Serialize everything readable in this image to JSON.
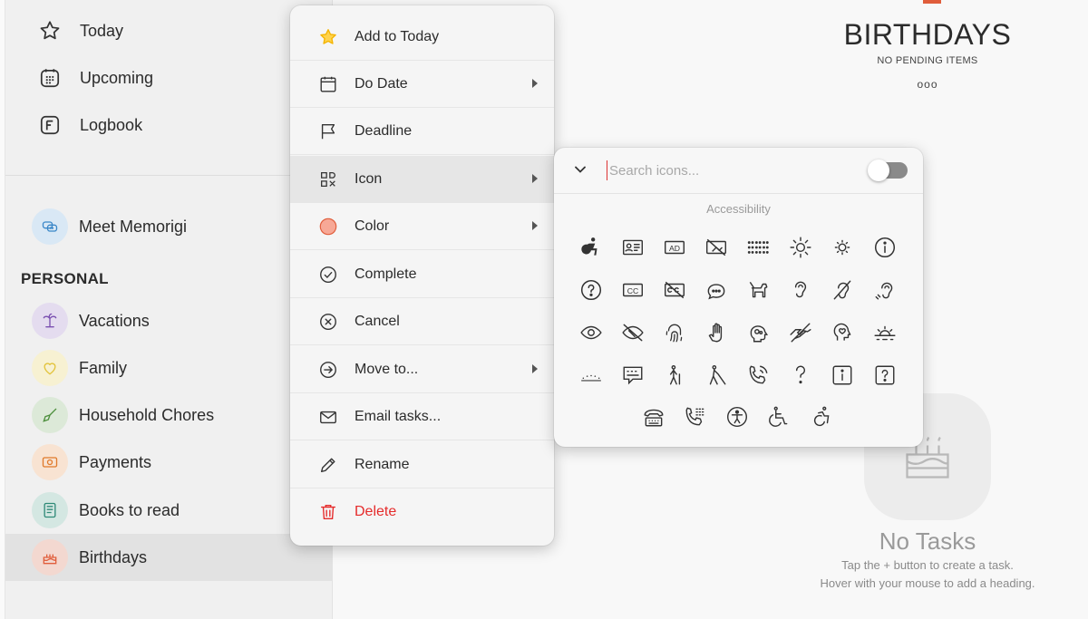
{
  "sidebar": {
    "nav": [
      {
        "label": "Today",
        "icon": "star-icon"
      },
      {
        "label": "Upcoming",
        "icon": "calendar-grid-icon"
      },
      {
        "label": "Logbook",
        "icon": "logbook-icon"
      }
    ],
    "meet": {
      "label": "Meet Memorigi",
      "icon": "chat-bubbles-icon",
      "color": "#d9e8f5"
    },
    "section": "PERSONAL",
    "lists": [
      {
        "label": "Vacations",
        "icon": "palm-tree-icon",
        "bg": "#e4dcef",
        "fg": "#7a4fb0"
      },
      {
        "label": "Family",
        "icon": "heart-icon",
        "bg": "#f7f1d2",
        "fg": "#e2c33b"
      },
      {
        "label": "Household Chores",
        "icon": "broom-icon",
        "bg": "#dce9d8",
        "fg": "#4c8f3c"
      },
      {
        "label": "Payments",
        "icon": "banknote-icon",
        "bg": "#f8e3d2",
        "fg": "#e07a2b"
      },
      {
        "label": "Books to read",
        "icon": "book-icon",
        "bg": "#d4e7e2",
        "fg": "#2f8a78"
      },
      {
        "label": "Birthdays",
        "icon": "cake-icon",
        "bg": "#f3d8d0",
        "fg": "#e05d3b"
      }
    ]
  },
  "main": {
    "title": "BIRTHDAYS",
    "subtitle": "NO PENDING ITEMS",
    "more": "ooo",
    "empty_title": "No Tasks",
    "empty_line1": "Tap the + button to create a task.",
    "empty_line2": "Hover with your mouse to add a heading."
  },
  "menu": {
    "items": [
      {
        "label": "Add to Today",
        "icon": "star-icon"
      },
      {
        "label": "Do Date",
        "icon": "calendar-icon"
      },
      {
        "label": "Deadline",
        "icon": "flag-icon"
      },
      {
        "label": "Icon",
        "icon": "icons-grid-icon"
      },
      {
        "label": "Color",
        "icon": "color-dot-icon"
      },
      {
        "label": "Complete",
        "icon": "check-circle-icon"
      },
      {
        "label": "Cancel",
        "icon": "x-circle-icon"
      },
      {
        "label": "Move to...",
        "icon": "arrow-circle-icon"
      },
      {
        "label": "Email tasks...",
        "icon": "envelope-icon"
      },
      {
        "label": "Rename",
        "icon": "pencil-icon"
      },
      {
        "label": "Delete",
        "icon": "trash-icon"
      }
    ]
  },
  "picker": {
    "search_placeholder": "Search icons...",
    "category": "Accessibility"
  },
  "colors": {
    "accent": "#e05d3b",
    "danger": "#e52b2b",
    "star": "#f4b400"
  }
}
